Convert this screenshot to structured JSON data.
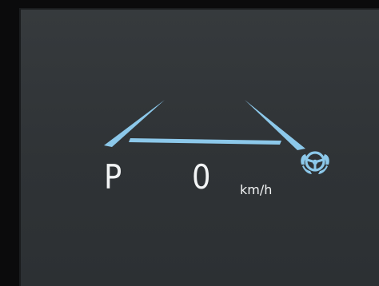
{
  "display": {
    "gear": "P",
    "speed": "0",
    "speed_unit": "km/h"
  },
  "icons": {
    "lane_assist": "lane-lines-icon",
    "steering_assist": "steering-assist-icon"
  },
  "colors": {
    "accent": "#8cc8ea",
    "text": "#f2f4f5",
    "screen": "#33373a"
  }
}
